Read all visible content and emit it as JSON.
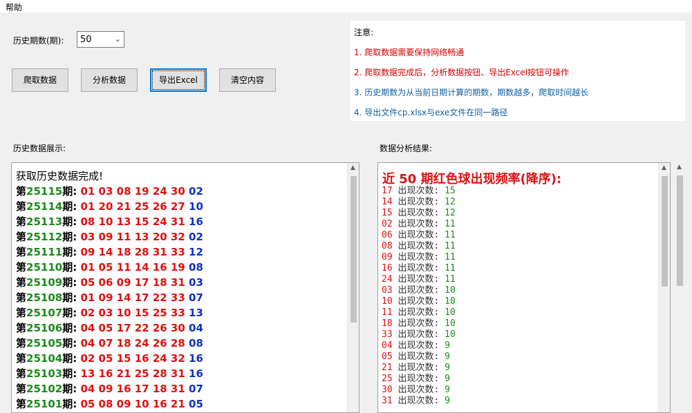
{
  "menu": {
    "help": "帮助"
  },
  "controls": {
    "periods_label": "历史期数(期):",
    "periods_value": "50",
    "buttons": {
      "fetch": "爬取数据",
      "analyze": "分析数据",
      "export": "导出Excel",
      "clear": "清空内容"
    }
  },
  "notice": {
    "title": "注意:",
    "line1": "1. 爬取数据需要保持网络畅通",
    "line2": "2. 爬取数据完成后，分析数据按钮、导出Excel按钮可操作",
    "line3": "3. 历史期数为从当前日期计算的期数，期数越多，爬取时间越长",
    "line4": "4. 导出文件cp.xlsx与exe文件在同一路径",
    "colors": {
      "red": "#d40000",
      "blue": "#1060a0"
    }
  },
  "history": {
    "label": "历史数据展示:",
    "status": "获取历史数据完成!",
    "prefix": "第",
    "suffix": "期:",
    "rows": [
      {
        "period": "25115",
        "red": "01 03 08 19 24 30",
        "blue": "02"
      },
      {
        "period": "25114",
        "red": "01 20 21 25 26 27",
        "blue": "10"
      },
      {
        "period": "25113",
        "red": "08 10 13 15 24 31",
        "blue": "16"
      },
      {
        "period": "25112",
        "red": "03 09 11 13 20 32",
        "blue": "02"
      },
      {
        "period": "25111",
        "red": "09 14 18 28 31 33",
        "blue": "12"
      },
      {
        "period": "25110",
        "red": "01 05 11 14 16 19",
        "blue": "08"
      },
      {
        "period": "25109",
        "red": "05 06 09 17 18 31",
        "blue": "03"
      },
      {
        "period": "25108",
        "red": "01 09 14 17 22 33",
        "blue": "07"
      },
      {
        "period": "25107",
        "red": "02 03 10 15 25 33",
        "blue": "13"
      },
      {
        "period": "25106",
        "red": "04 05 17 22 26 30",
        "blue": "04"
      },
      {
        "period": "25105",
        "red": "04 07 18 24 26 28",
        "blue": "08"
      },
      {
        "period": "25104",
        "red": "02 05 15 16 24 32",
        "blue": "16"
      },
      {
        "period": "25103",
        "red": "13 16 21 25 28 31",
        "blue": "16"
      },
      {
        "period": "25102",
        "red": "04 09 16 17 18 31",
        "blue": "07"
      },
      {
        "period": "25101",
        "red": "05 08 09 10 16 21",
        "blue": "05"
      }
    ]
  },
  "analysis": {
    "label": "数据分析结果:",
    "title": "近 50 期红色球出现频率(降序):",
    "count_label": "出现次数:",
    "rows": [
      {
        "num": "17",
        "count": "15"
      },
      {
        "num": "14",
        "count": "12"
      },
      {
        "num": "15",
        "count": "12"
      },
      {
        "num": "02",
        "count": "11"
      },
      {
        "num": "06",
        "count": "11"
      },
      {
        "num": "08",
        "count": "11"
      },
      {
        "num": "09",
        "count": "11"
      },
      {
        "num": "16",
        "count": "11"
      },
      {
        "num": "24",
        "count": "11"
      },
      {
        "num": "03",
        "count": "10"
      },
      {
        "num": "10",
        "count": "10"
      },
      {
        "num": "11",
        "count": "10"
      },
      {
        "num": "18",
        "count": "10"
      },
      {
        "num": "33",
        "count": "10"
      },
      {
        "num": "04",
        "count": "9"
      },
      {
        "num": "05",
        "count": "9"
      },
      {
        "num": "21",
        "count": "9"
      },
      {
        "num": "25",
        "count": "9"
      },
      {
        "num": "30",
        "count": "9"
      },
      {
        "num": "31",
        "count": "9"
      }
    ]
  }
}
